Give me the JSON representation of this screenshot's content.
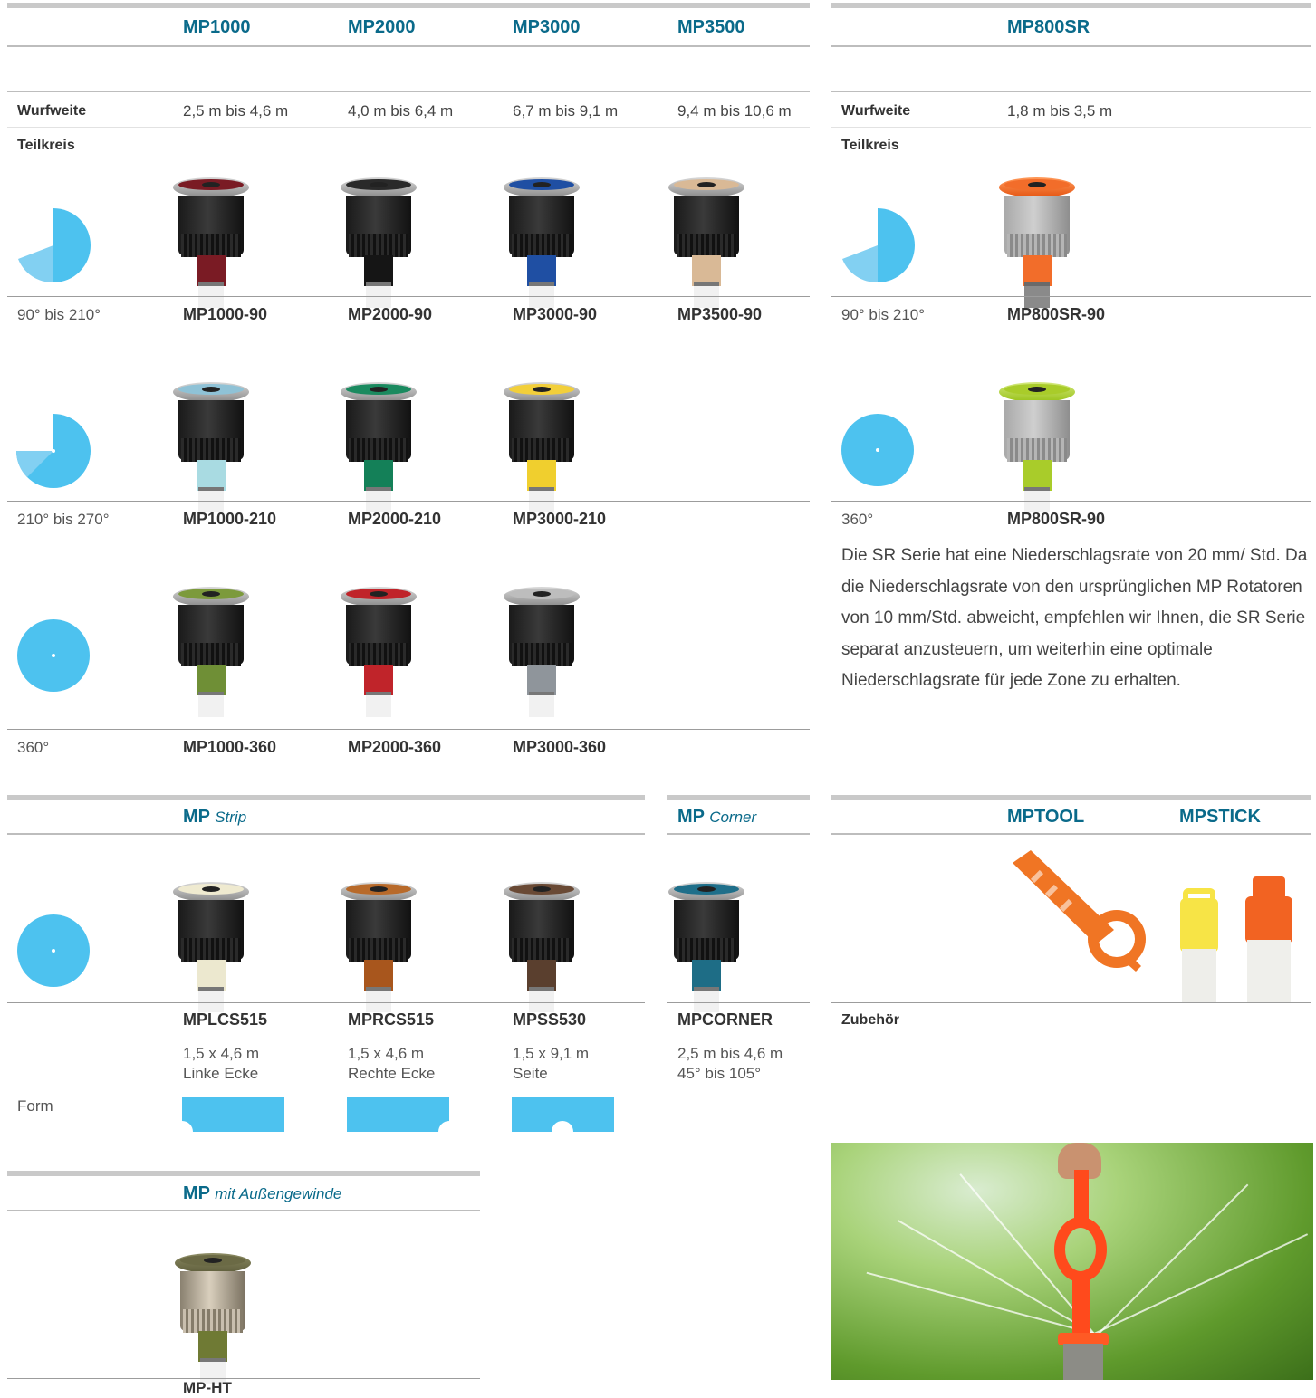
{
  "top_left": {
    "columns": [
      "MP1000",
      "MP2000",
      "MP3000",
      "MP3500"
    ],
    "wurfweite_label": "Wurfweite",
    "wurfweite_values": [
      "2,5 m bis 4,6 m",
      "4,0 m bis 6,4 m",
      "6,7 m bis 9,1 m",
      "9,4 m bis 10,6 m"
    ],
    "teilkreis_label": "Teilkreis",
    "rows": [
      {
        "range": "90° bis 210°",
        "models": [
          "MP1000-90",
          "MP2000-90",
          "MP3000-90",
          "MP3500-90"
        ]
      },
      {
        "range": "210° bis 270°",
        "models": [
          "MP1000-210",
          "MP2000-210",
          "MP3000-210"
        ]
      },
      {
        "range": "360°",
        "models": [
          "MP1000-360",
          "MP2000-360",
          "MP3000-360"
        ]
      }
    ]
  },
  "top_right": {
    "column": "MP800SR",
    "wurfweite_label": "Wurfweite",
    "wurfweite_value": "1,8 m bis 3,5 m",
    "teilkreis_label": "Teilkreis",
    "rows": [
      {
        "range": "90° bis 210°",
        "model": "MP800SR-90"
      },
      {
        "range": "360°",
        "model": "MP800SR-90"
      }
    ],
    "note": "Die SR Serie hat eine Niederschlagsrate von 20 mm/ Std. Da die Niederschlagsrate von den ursprünglichen MP Rotatoren von 10 mm/Std. abweicht, empfehlen wir Ihnen, die SR Serie separat anzusteuern, um weiterhin eine optimale Niederschlagsrate für jede Zone zu erhalten."
  },
  "strip": {
    "title_mp": "MP",
    "title_suffix": "Strip",
    "models": [
      "MPLCS515",
      "MPRCS515",
      "MPSS530"
    ],
    "specs": [
      {
        "size": "1,5 x 4,6 m",
        "desc": "Linke Ecke"
      },
      {
        "size": "1,5 x 4,6 m",
        "desc": "Rechte Ecke"
      },
      {
        "size": "1,5 x 9,1 m",
        "desc": "Seite"
      }
    ],
    "form_label": "Form"
  },
  "corner": {
    "title_mp": "MP",
    "title_suffix": "Corner",
    "model": "MPCORNER",
    "spec1": "2,5 m bis 4,6 m",
    "spec2": "45° bis 105°"
  },
  "accessories": {
    "columns": [
      "MPTOOL",
      "MPSTICK"
    ],
    "label": "Zubehör"
  },
  "external_thread": {
    "title_mp": "MP",
    "title_suffix": "mit Außengewinde",
    "model": "MP-HT"
  },
  "colors": {
    "accent": "#0a6a8a",
    "arc_blue": "#4dc2ef",
    "arc_light": "#82d0f2"
  }
}
